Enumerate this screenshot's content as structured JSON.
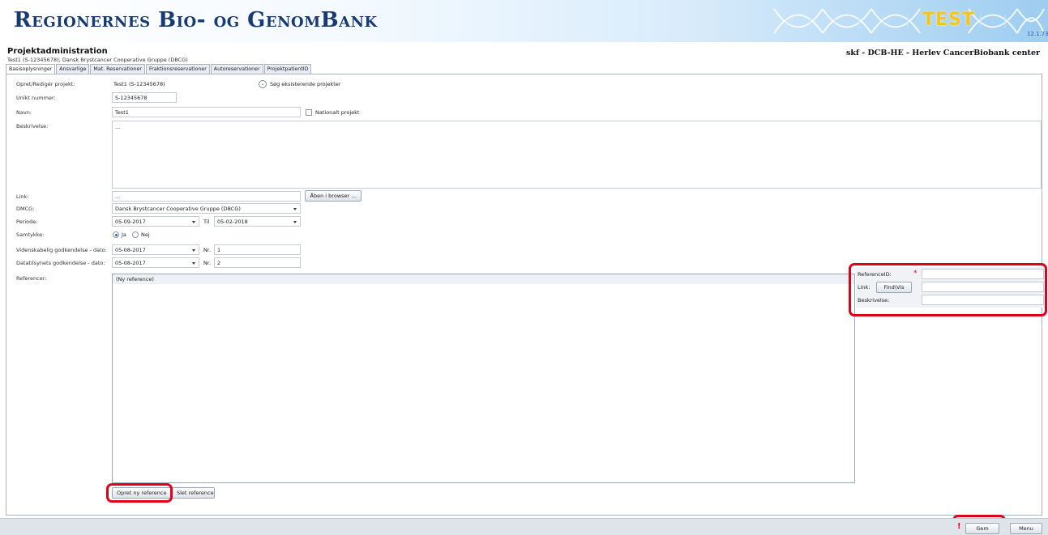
{
  "banner": {
    "title": "Regionernes Bio- og GenomBank",
    "env_label": "TEST",
    "version": "12.1.73"
  },
  "header": {
    "title": "Projektadministration",
    "subtitle": "Test1 (S-12345678); Dansk Brystcancer Cooperative Gruppe (DBCG)",
    "user_info": "skf - DCB-HE - Herlev CancerBiobank center"
  },
  "tabs": [
    {
      "label": "Basisoplysninger",
      "active": true
    },
    {
      "label": "Ansvarlige"
    },
    {
      "label": "Mat. Reservationer"
    },
    {
      "label": "Fraktionsreservationer"
    },
    {
      "label": "Autoreservationer"
    },
    {
      "label": "ProjektpatientID"
    }
  ],
  "form": {
    "opret_label": "Opret/Redigér projekt:",
    "opret_value": "Test1 (S-12345678)",
    "search_label": "Søg eksisterende projekter",
    "unikt_label": "Unikt nummer:",
    "unikt_value": "S-12345678",
    "navn_label": "Navn:",
    "navn_value": "Test1",
    "nationalt_label": "Nationalt projekt",
    "beskrivelse_label": "Beskrivelse:",
    "beskrivelse_value": "...",
    "link_label": "Link:",
    "link_value": "...",
    "open_browser_label": "Åben i browser ...",
    "dmcg_label": "DMCG:",
    "dmcg_value": "Dansk Brystcancer Cooperative Gruppe (DBCG)",
    "periode_label": "Periode:",
    "periode_from": "05-09-2017",
    "til_label": "Til",
    "periode_to": "05-02-2018",
    "samtykke_label": "Samtykke:",
    "ja_label": "Ja",
    "nej_label": "Nej",
    "vid_label": "Videnskabelig godkendelse - dato:",
    "vid_date": "05-08-2017",
    "nr_label": "Nr.",
    "vid_nr": "1",
    "data_label": "Datatilsynets godkendelse - dato:",
    "data_date": "05-08-2017",
    "data_nr": "2",
    "referencer_label": "Referencer:",
    "new_reference_row": "(Ny reference)",
    "create_ref_label": "Opret ny reference",
    "delete_ref_label": "Slet reference"
  },
  "ref_panel": {
    "id_label": "ReferenceID:",
    "required_mark": "*",
    "link_label": "Link:",
    "find_label": "Find\\Vis",
    "desc_label": "Beskrivelse:"
  },
  "footer": {
    "warning": "!",
    "save_label": "Gem",
    "menu_label": "Menu"
  },
  "colors": {
    "highlight": "#e0001a",
    "brand": "#173a73"
  }
}
